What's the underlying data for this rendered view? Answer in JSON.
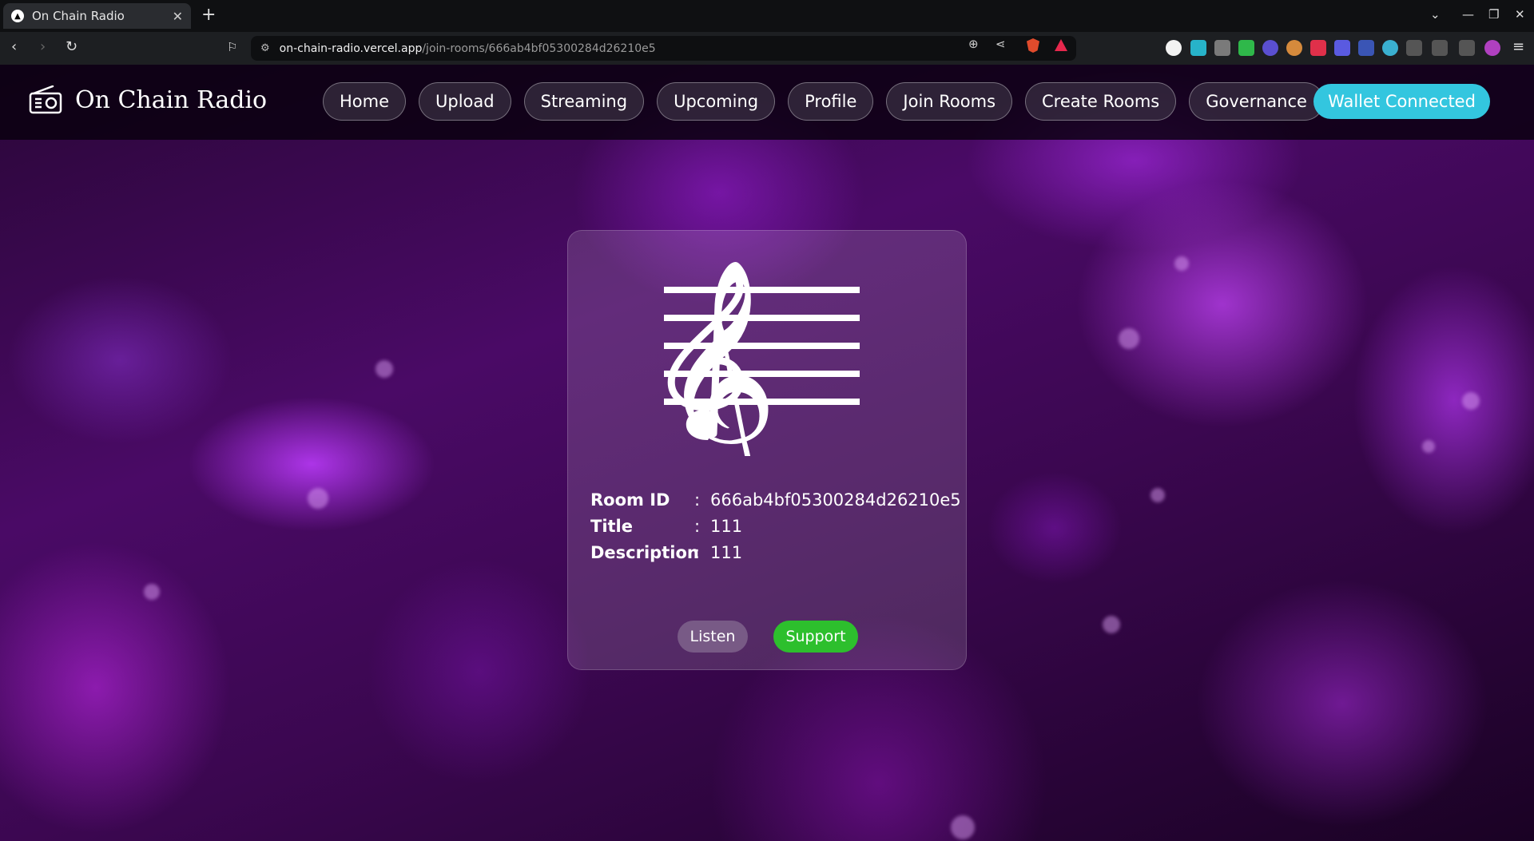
{
  "browser": {
    "tab_title": "On Chain Radio",
    "url_host": "on-chain-radio.vercel.app",
    "url_path": "/join-rooms/666ab4bf05300284d26210e5"
  },
  "nav": {
    "brand": "On Chain Radio",
    "links": [
      "Home",
      "Upload",
      "Streaming",
      "Upcoming",
      "Profile",
      "Join Rooms",
      "Create Rooms",
      "Governance"
    ],
    "wallet_label": "Wallet Connected",
    "wallet_color": "#33c6df"
  },
  "room": {
    "labels": {
      "id": "Room ID",
      "title": "Title",
      "description": "Description"
    },
    "separator": ":",
    "id": "666ab4bf05300284d26210e5",
    "title": "111",
    "description": "111",
    "listen_label": "Listen",
    "support_label": "Support",
    "support_color": "#2dbf2d"
  }
}
